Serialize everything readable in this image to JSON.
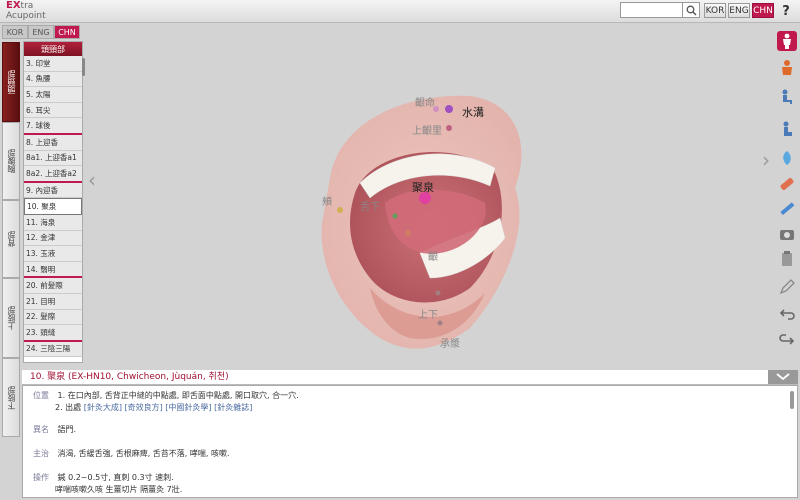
{
  "app": {
    "logo_ex": "EX",
    "logo_line1": "tra",
    "logo_line2": "Acupoint"
  },
  "search": {
    "placeholder": ""
  },
  "languages": {
    "kor": "KOR",
    "eng": "ENG",
    "chn": "CHN"
  },
  "help_label": "?",
  "sublang": [
    "KOR",
    "ENG",
    "CHN"
  ],
  "vtabs": [
    "頭頸部",
    "胸腹部",
    "背部",
    "上肢部",
    "下肢部"
  ],
  "list": {
    "header": "頭頸部",
    "items": [
      "3. 印堂",
      "4. 魚腰",
      "5. 太陽",
      "6. 耳尖",
      "7. 球後",
      "8. 上迎香",
      "8a1. 上迎香a1",
      "8a2. 上迎香a2",
      "9. 內迎香",
      "10. 聚泉",
      "11. 海泉",
      "12. 金津",
      "13. 玉液",
      "14. 翳明",
      "20. 前髮際",
      "21. 目明",
      "22. 髮際",
      "23. 頭縫",
      "24. 三陰三陽"
    ]
  },
  "scene": {
    "labels": {
      "yinjiao": "齦命",
      "shuigou": "水溝",
      "shangyingli": "上齦里",
      "juquan": "聚泉",
      "shexia": "舌下",
      "jiaying": "頰",
      "yinjiao2": "齦",
      "chengjiang": "承漿",
      "shangxia": "上下"
    }
  },
  "detail": {
    "title": "10. 聚泉 (EX-HN10, Chwicheon, Jùquán, 취천)",
    "position_label": "位置",
    "position_1": "1. 在口內部, 舌背正中縫的中點處, 即舌面中點處, 開口取穴, 合一穴.",
    "position_2_prefix": "2. 出處",
    "position_2_links": "[針灸大成] [奇效良方] [中國針灸學] [針灸雜誌]",
    "alias_label": "異名",
    "alias": "語門.",
    "indication_label": "主治",
    "indication": "消渴, 舌緩舌強, 舌根麻痺, 舌苔不落, 哮喘, 咳嗽.",
    "method_label": "操作",
    "method_1": "鍼 0.2~0.5寸, 直刺 0.3寸 速刺.",
    "method_2": "哮喘咳嗽久咳 生薑切片 隔薑灸 7壯."
  },
  "colors": {
    "accent": "#c0194e",
    "dark_red": "#7d1224"
  },
  "icons": {
    "toolbar": [
      "person-front-icon",
      "person-side-icon",
      "person-sitting-icon",
      "person-standing-icon",
      "meridian-icon",
      "tape-icon",
      "ruler-icon",
      "camera-icon",
      "clipboard-icon",
      "pencil-icon",
      "undo-icon",
      "redo-icon"
    ]
  }
}
